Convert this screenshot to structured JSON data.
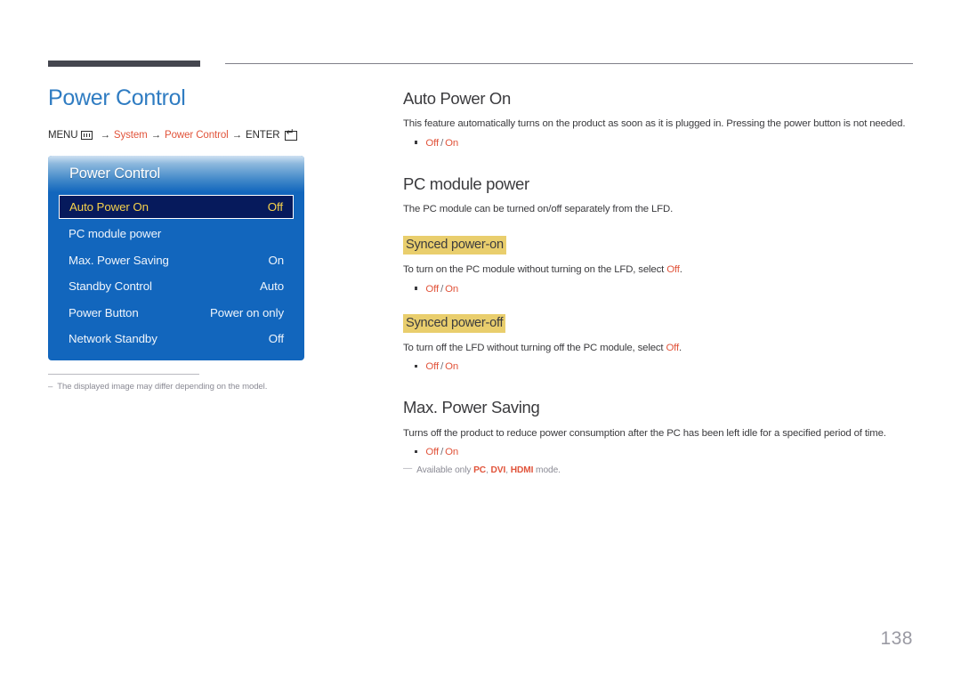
{
  "page": {
    "number": "138",
    "title": "Power Control"
  },
  "breadcrumb": {
    "menu_label": "MENU",
    "menu_icon": "menu-grid-icon",
    "arrow": "→",
    "crumb1": "System",
    "crumb2": "Power Control",
    "enter_label": "ENTER",
    "enter_icon": "enter-return-icon"
  },
  "osd": {
    "title": "Power Control",
    "rows": [
      {
        "label": "Auto Power On",
        "value": "Off",
        "selected": true
      },
      {
        "label": "PC module power",
        "value": "",
        "selected": false
      },
      {
        "label": "Max. Power Saving",
        "value": "On",
        "selected": false
      },
      {
        "label": "Standby Control",
        "value": "Auto",
        "selected": false
      },
      {
        "label": "Power Button",
        "value": "Power on only",
        "selected": false
      },
      {
        "label": "Network Standby",
        "value": "Off",
        "selected": false
      }
    ]
  },
  "left_note": {
    "dash": "–",
    "text": "The displayed image may differ depending on the model."
  },
  "sections": {
    "auto_power_on": {
      "heading": "Auto Power On",
      "body": "This feature automatically turns on the product as soon as it is plugged in. Pressing the power button is not needed.",
      "option_off": "Off",
      "option_sep": "/",
      "option_on": "On"
    },
    "pc_module_power": {
      "heading": "PC module power",
      "body": "The PC module can be turned on/off separately from the LFD.",
      "synced_on": {
        "subheading": "Synced power-on",
        "body_pre": "To turn on the PC module without turning on the LFD, select ",
        "body_accent": "Off",
        "body_post": ".",
        "option_off": "Off",
        "option_sep": "/",
        "option_on": "On"
      },
      "synced_off": {
        "subheading": "Synced power-off",
        "body_pre": "To turn off the LFD without turning off the PC module, select ",
        "body_accent": "Off",
        "body_post": ".",
        "option_off": "Off",
        "option_sep": "/",
        "option_on": "On"
      }
    },
    "max_power_saving": {
      "heading": "Max. Power Saving",
      "body": "Turns off the product to reduce power consumption after the PC has been left idle for a specified period of time.",
      "option_off": "Off",
      "option_sep": "/",
      "option_on": "On",
      "note": {
        "emdash": "—",
        "pre": "Available only ",
        "mode1": "PC",
        "comma1": ", ",
        "mode2": "DVI",
        "comma2": ", ",
        "mode3": "HDMI",
        "post": " mode."
      }
    }
  },
  "colors": {
    "title_blue": "#2f7cc2",
    "accent_orange": "#e1543b",
    "osd_blue": "#1266bd",
    "osd_selected_bg": "#061a5c",
    "osd_selected_text": "#f5d14b",
    "highlight_gold": "#e9ce6d",
    "rule_dark": "#45464f",
    "body_text": "#3b3b3e",
    "muted_gray": "#8b8b95"
  }
}
